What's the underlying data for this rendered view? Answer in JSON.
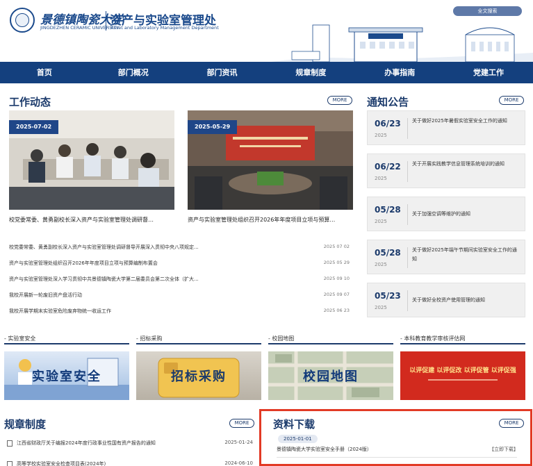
{
  "header": {
    "university_cn": "景德镇陶瓷大学",
    "university_en": "JINGDEZHEN CERAMIC UNIVERSITY",
    "dept_cn": "资产与实验室管理处",
    "dept_en": "Asset and Laboratory Management Department",
    "search_label": "全文搜索"
  },
  "nav": [
    "首页",
    "部门概况",
    "部门资讯",
    "规章制度",
    "办事指南",
    "党建工作"
  ],
  "news": {
    "title": "工作动态",
    "more": "MORE",
    "featured": [
      {
        "date": "2025-07-02",
        "caption": "校党委常委、黄勇副校长深入资产与实验室管理处调研督…"
      },
      {
        "date": "2025-05-29",
        "caption": "资产与实验室管理处组织召开2026年年度项目立项与预算…"
      }
    ],
    "list": [
      {
        "title": "校党委常委、黄勇副校长深入资产与实验室管理处调研督导开展深入贯彻中央八项规定...",
        "date": "2025 07 02"
      },
      {
        "title": "资产与实验室管理处组织召开2026年年度项目立项与预算编制布置会",
        "date": "2025 05 29"
      },
      {
        "title": "资产与实验室管理处深入学习贯彻中共景德镇陶瓷大学第二届委员会第二次全体（扩大...",
        "date": "2025 09 10"
      },
      {
        "title": "我校开展新一轮废旧资产盘活行动",
        "date": "2025 09 07"
      },
      {
        "title": "我校开展学期末实验室危险废弃物统一收运工作",
        "date": "2025 06 23"
      }
    ]
  },
  "notices": {
    "title": "通知公告",
    "more": "MORE",
    "items": [
      {
        "date": "06/23",
        "year": "2025",
        "title": "关于做好2025年暑假实验室安全工作的通知"
      },
      {
        "date": "06/22",
        "year": "2025",
        "title": "关于开展实践教学信息管理系统培训的通知"
      },
      {
        "date": "05/28",
        "year": "2025",
        "title": "关于加强空调等维护的通知"
      },
      {
        "date": "05/28",
        "year": "2025",
        "title": "关于做好2025年端午节期间实验室安全工作的通知"
      },
      {
        "date": "05/23",
        "year": "2025",
        "title": "关于做好全校资产使用管理的通知"
      }
    ]
  },
  "quick": [
    {
      "label": "- 实验室安全",
      "tile_text": "实验室安全"
    },
    {
      "label": "- 招标采购",
      "tile_text": "招标采购"
    },
    {
      "label": "- 校园地图",
      "tile_text": "校园地图"
    },
    {
      "label": "- 本科教育教学审核评估网",
      "tile_text": "以评促建 以评促改 以评促管 以评促强"
    }
  ],
  "rules": {
    "title": "规章制度",
    "more": "MORE",
    "items": [
      {
        "title": "江西省财政厅关于编报2024年度行政事业性国有资产报告的通知",
        "date": "2025-01-24"
      },
      {
        "title": "高等学校实验室安全检查项目表(2024年)",
        "date": "2024-06-10"
      }
    ]
  },
  "downloads": {
    "title": "资料下载",
    "more": "MORE",
    "items": [
      {
        "date": "2025-01-01",
        "title": "景德镇陶瓷大学实验室安全手册（2024版）",
        "action": "【立即下载】"
      }
    ]
  },
  "colors": {
    "primary": "#14407e",
    "highlight_box": "#e23a25"
  }
}
